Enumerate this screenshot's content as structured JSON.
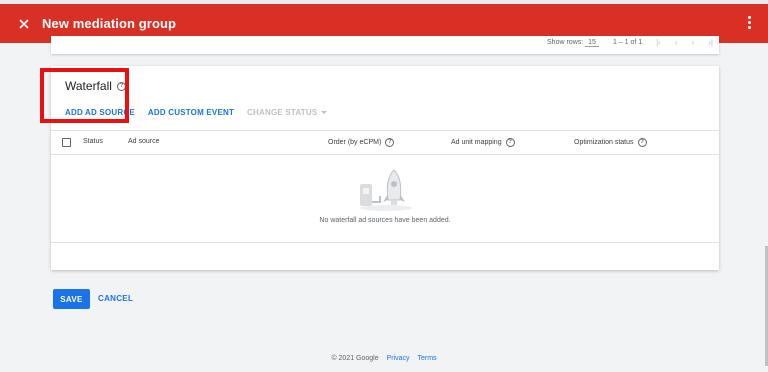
{
  "app_bar": {
    "title": "New mediation group",
    "close_icon": "close-icon",
    "more_icon": "more-vert-icon",
    "color": "#d93025"
  },
  "pagination": {
    "rows_label": "Show rows:",
    "rows_value": "15",
    "range": "1 – 1 of 1"
  },
  "waterfall": {
    "heading": "Waterfall",
    "actions": {
      "add_ad_source": "ADD AD SOURCE",
      "add_custom_event": "ADD CUSTOM EVENT",
      "change_status": "CHANGE STATUS"
    },
    "columns": [
      "Status",
      "Ad source",
      "Order (by eCPM)",
      "Ad unit mapping",
      "Optimization status"
    ],
    "empty_message": "No waterfall ad sources have been added."
  },
  "buttons": {
    "save": "SAVE",
    "cancel": "CANCEL"
  },
  "footer": {
    "copyright": "© 2021 Google",
    "privacy": "Privacy",
    "terms": "Terms"
  },
  "colors": {
    "accent": "#1a73e8",
    "highlight": "#e81010"
  }
}
